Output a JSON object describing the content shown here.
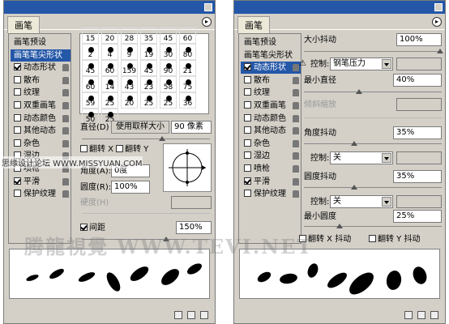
{
  "left_panel": {
    "tab_label": "画笔",
    "sidebar": [
      {
        "label": "画笔预设",
        "checkbox": false,
        "checked": false,
        "selected": false,
        "lock": false
      },
      {
        "label": "画笔笔尖形状",
        "checkbox": false,
        "checked": false,
        "selected": true,
        "lock": false
      },
      {
        "label": "动态形状",
        "checkbox": true,
        "checked": true,
        "selected": false,
        "lock": true
      },
      {
        "label": "散布",
        "checkbox": true,
        "checked": false,
        "selected": false,
        "lock": true
      },
      {
        "label": "纹理",
        "checkbox": true,
        "checked": false,
        "selected": false,
        "lock": true
      },
      {
        "label": "双重画笔",
        "checkbox": true,
        "checked": false,
        "selected": false,
        "lock": true
      },
      {
        "label": "动态颜色",
        "checkbox": true,
        "checked": false,
        "selected": false,
        "lock": true
      },
      {
        "label": "其他动态",
        "checkbox": true,
        "checked": false,
        "selected": false,
        "lock": true
      },
      {
        "label": "杂色",
        "checkbox": true,
        "checked": false,
        "selected": false,
        "lock": true
      },
      {
        "label": "湿边",
        "checkbox": true,
        "checked": false,
        "selected": false,
        "lock": true
      },
      {
        "label": "喷枪",
        "checkbox": true,
        "checked": false,
        "selected": false,
        "lock": true
      },
      {
        "label": "平滑",
        "checkbox": true,
        "checked": true,
        "selected": false,
        "lock": true
      },
      {
        "label": "保护纹理",
        "checkbox": true,
        "checked": false,
        "selected": false,
        "lock": true
      }
    ],
    "brush_sizes": [
      "15",
      "20",
      "28",
      "35",
      "45",
      "60",
      "2",
      "4",
      "9",
      "19",
      "30",
      "80",
      "45",
      "60",
      "159",
      "45",
      "90",
      "21",
      "60",
      "14",
      "43",
      "23",
      "58",
      "75",
      "59",
      "25",
      "20",
      "25",
      "25",
      "36",
      "50",
      "25"
    ],
    "diameter_label": "直径(D)",
    "sample_button": "使用取样大小",
    "diameter_value": "90 像素",
    "flip_x_label": "翻转 X",
    "flip_y_label": "翻转 Y",
    "angle_label": "角度(A):",
    "angle_value": "0度",
    "roundness_label": "圆度(R):",
    "roundness_value": "100%",
    "hardness_label": "硬度(H)",
    "spacing_label": "间距",
    "spacing_value": "150%"
  },
  "right_panel": {
    "tab_label": "画笔",
    "sidebar": [
      {
        "label": "画笔预设",
        "checkbox": false,
        "checked": false,
        "selected": false,
        "lock": false
      },
      {
        "label": "画笔笔尖形状",
        "checkbox": false,
        "checked": false,
        "selected": false,
        "lock": false
      },
      {
        "label": "动态形状",
        "checkbox": true,
        "checked": true,
        "selected": true,
        "lock": true
      },
      {
        "label": "散布",
        "checkbox": true,
        "checked": false,
        "selected": false,
        "lock": true
      },
      {
        "label": "纹理",
        "checkbox": true,
        "checked": false,
        "selected": false,
        "lock": true
      },
      {
        "label": "双重画笔",
        "checkbox": true,
        "checked": false,
        "selected": false,
        "lock": true
      },
      {
        "label": "动态颜色",
        "checkbox": true,
        "checked": false,
        "selected": false,
        "lock": true
      },
      {
        "label": "其他动态",
        "checkbox": true,
        "checked": false,
        "selected": false,
        "lock": true
      },
      {
        "label": "杂色",
        "checkbox": true,
        "checked": false,
        "selected": false,
        "lock": true
      },
      {
        "label": "湿边",
        "checkbox": true,
        "checked": false,
        "selected": false,
        "lock": true
      },
      {
        "label": "喷枪",
        "checkbox": true,
        "checked": false,
        "selected": false,
        "lock": true
      },
      {
        "label": "平滑",
        "checkbox": true,
        "checked": true,
        "selected": false,
        "lock": true
      },
      {
        "label": "保护纹理",
        "checkbox": true,
        "checked": false,
        "selected": false,
        "lock": true
      }
    ],
    "size_jitter_label": "大小抖动",
    "size_jitter_value": "100%",
    "control_label": "控制:",
    "control_value": "钢笔压力",
    "min_diameter_label": "最小直径",
    "min_diameter_value": "40%",
    "tilt_scale_label": "倾斜缩放",
    "angle_jitter_label": "角度抖动",
    "angle_jitter_value": "35%",
    "angle_control_value": "关",
    "roundness_jitter_label": "圆度抖动",
    "roundness_jitter_value": "35%",
    "roundness_control_value": "关",
    "min_roundness_label": "最小圆度",
    "min_roundness_value": "25%",
    "flip_x_jitter_label": "翻转 X 抖动",
    "flip_y_jitter_label": "翻转 Y 抖动"
  },
  "watermark": {
    "main": "腾龍視覺 WWW.TEVI.NET",
    "side": "思缘设计论坛 WWW.MISSYUAN.COM"
  },
  "colors": {
    "selection": "#2457a8",
    "panel_bg": "#d4d0c8",
    "title_bar": "#2457a8"
  }
}
